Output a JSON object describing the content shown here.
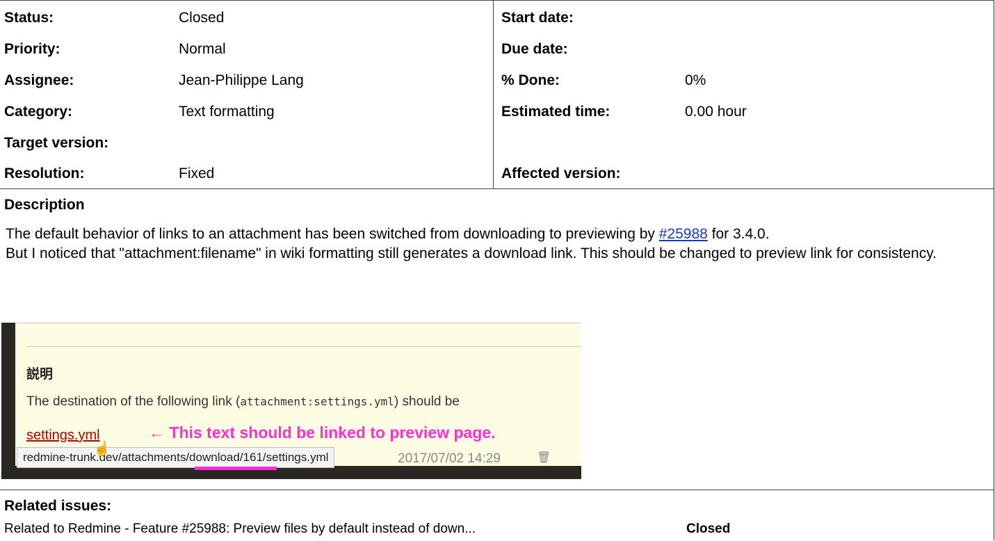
{
  "attributes": {
    "left": [
      {
        "label": "Status:",
        "value": "Closed"
      },
      {
        "label": "Priority:",
        "value": "Normal"
      },
      {
        "label": "Assignee:",
        "value": "Jean-Philippe Lang"
      },
      {
        "label": "Category:",
        "value": "Text formatting"
      },
      {
        "label": "Target version:",
        "value": ""
      },
      {
        "label": "Resolution:",
        "value": "Fixed"
      }
    ],
    "right": [
      {
        "label": "Start date:",
        "value": ""
      },
      {
        "label": "Due date:",
        "value": ""
      },
      {
        "label": "% Done:",
        "value": "0%"
      },
      {
        "label": "Estimated time:",
        "value": "0.00 hour"
      },
      {
        "label": "",
        "value": ""
      },
      {
        "label": "Affected version:",
        "value": ""
      }
    ]
  },
  "description": {
    "heading": "Description",
    "line1_before": "The default behavior of links to an attachment has been switched from downloading to previewing by ",
    "line1_link": "#25988",
    "line1_after": " for 3.4.0.",
    "line2": "But I noticed that \"attachment:filename\" in wiki formatting still generates a download link. This should be changed to preview link for consistency."
  },
  "screenshot": {
    "heading": "説明",
    "line_before": "The destination of the following link (",
    "line_code": "attachment:settings.yml",
    "line_after": ") should be",
    "link_text": "settings.yml",
    "arrow": "←",
    "annotation": "This text should be linked to preview page.",
    "status_url": "redmine-trunk.dev/attachments/download/161/settings.yml",
    "date_text": "2017/07/02 14:29",
    "colors": {
      "annotation": "#ff2fd3",
      "link": "#b00000"
    }
  },
  "related": {
    "heading": "Related issues:",
    "items": [
      {
        "text": "Related to Redmine - Feature #25988: Preview files by default instead of down...",
        "status": "Closed"
      }
    ]
  }
}
